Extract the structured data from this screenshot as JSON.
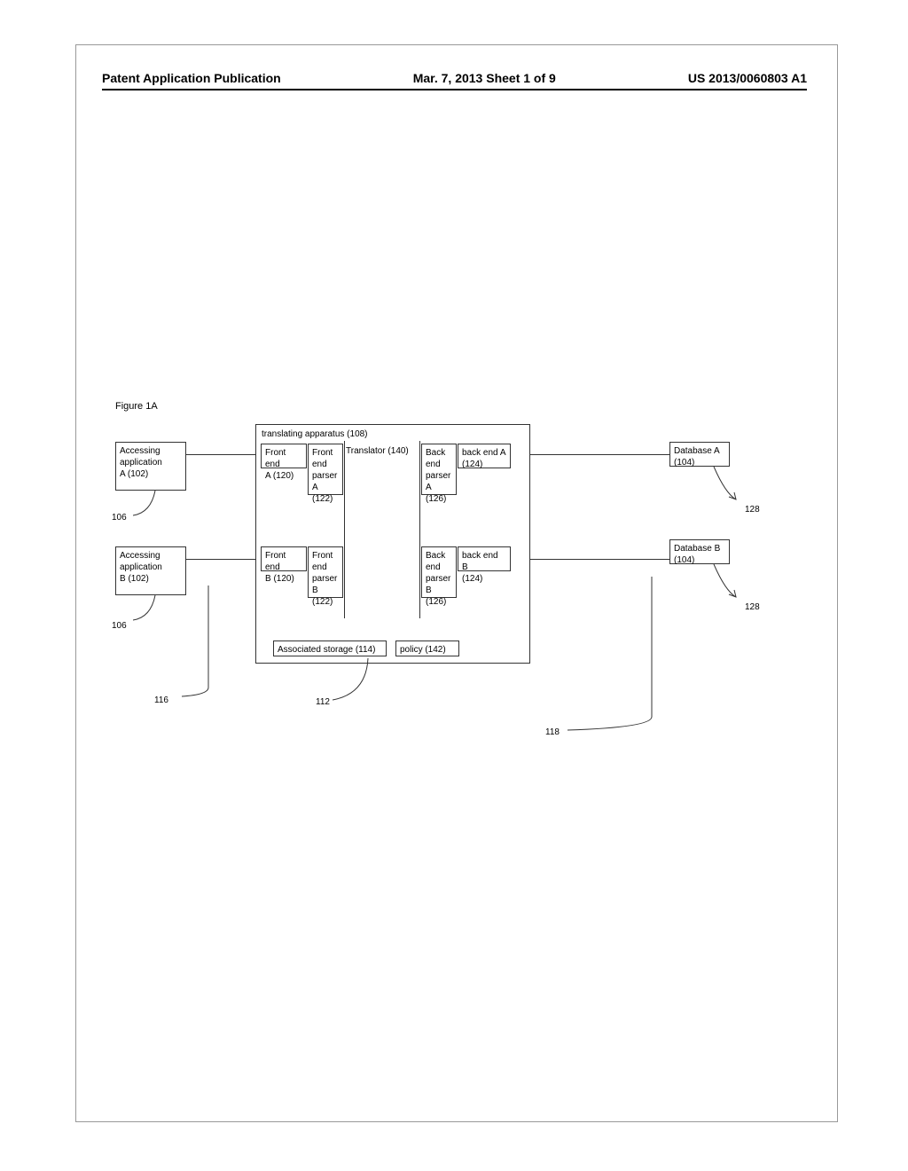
{
  "header": {
    "left": "Patent Application Publication",
    "center": "Mar. 7, 2013  Sheet 1 of 9",
    "right": "US 2013/0060803 A1"
  },
  "figure_label": "Figure 1A",
  "boxes": {
    "app_a": "Accessing\napplication\nA (102)",
    "app_b": "Accessing\napplication\nB (102)",
    "apparatus": "translating apparatus (108)",
    "fe_a": "Front end\nA (120)",
    "fe_b": "Front end\nB (120)",
    "fep_a": "Front\nend\nparser\nA (122)",
    "fep_b": "Front\nend\nparser\nB (122)",
    "translator": "Translator (140)",
    "bep_a": "Back\nend\nparser\nA (126)",
    "bep_b": "Back\nend\nparser B\n(126)",
    "be_a": "back end A\n(124)",
    "be_b": "back end B\n(124)",
    "storage": "Associated storage (114)",
    "policy": "policy (142)",
    "db_a": "Database A\n(104)",
    "db_b": "Database B\n(104)"
  },
  "refs": {
    "r106a": "106",
    "r106b": "106",
    "r116": "116",
    "r112": "112",
    "r118": "118",
    "r128a": "128",
    "r128b": "128"
  }
}
